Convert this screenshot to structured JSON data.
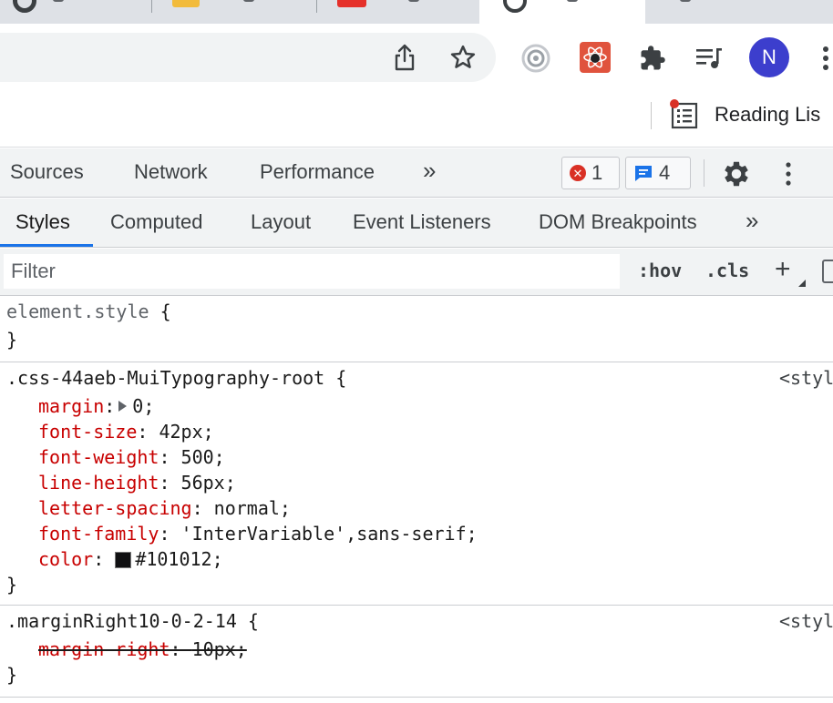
{
  "browser": {
    "avatar_initial": "N",
    "bookmarks": {
      "reading_list_label": "Reading Lis"
    }
  },
  "devtools": {
    "main_tabs": [
      "Sources",
      "Network",
      "Performance"
    ],
    "more_tabs_glyph": "»",
    "error_count": "1",
    "message_count": "4",
    "sub_tabs": [
      "Styles",
      "Computed",
      "Layout",
      "Event Listeners",
      "DOM Breakpoints"
    ],
    "active_sub_tab": "Styles",
    "filter": {
      "placeholder": "Filter",
      "value": ""
    },
    "hov_label": ":hov",
    "cls_label": ".cls",
    "plus_label": "+"
  },
  "styles": {
    "element_style": {
      "selector": "element.style",
      "open": "{",
      "close": "}"
    },
    "rule1": {
      "selector": ".css-44aeb-MuiTypography-root",
      "open": "{",
      "source": "<styl",
      "close": "}",
      "declarations": [
        {
          "prop": "margin",
          "value": "0;"
        },
        {
          "prop": "font-size",
          "value": "42px;"
        },
        {
          "prop": "font-weight",
          "value": "500;"
        },
        {
          "prop": "line-height",
          "value": "56px;"
        },
        {
          "prop": "letter-spacing",
          "value": "normal;"
        },
        {
          "prop": "font-family",
          "value": "'InterVariable',sans-serif;"
        },
        {
          "prop": "color",
          "value": "#101012;"
        }
      ]
    },
    "rule2": {
      "selector": ".marginRight10-0-2-14",
      "open": "{",
      "source": "<styl",
      "close": "}",
      "declarations": [
        {
          "prop": "margin-right",
          "value": "10px;"
        }
      ]
    }
  },
  "colors": {
    "accent": "#1a73e8",
    "error": "#d93025",
    "property": "#c80000",
    "avatar": "#3c3ecd",
    "swatch": "#101012"
  }
}
